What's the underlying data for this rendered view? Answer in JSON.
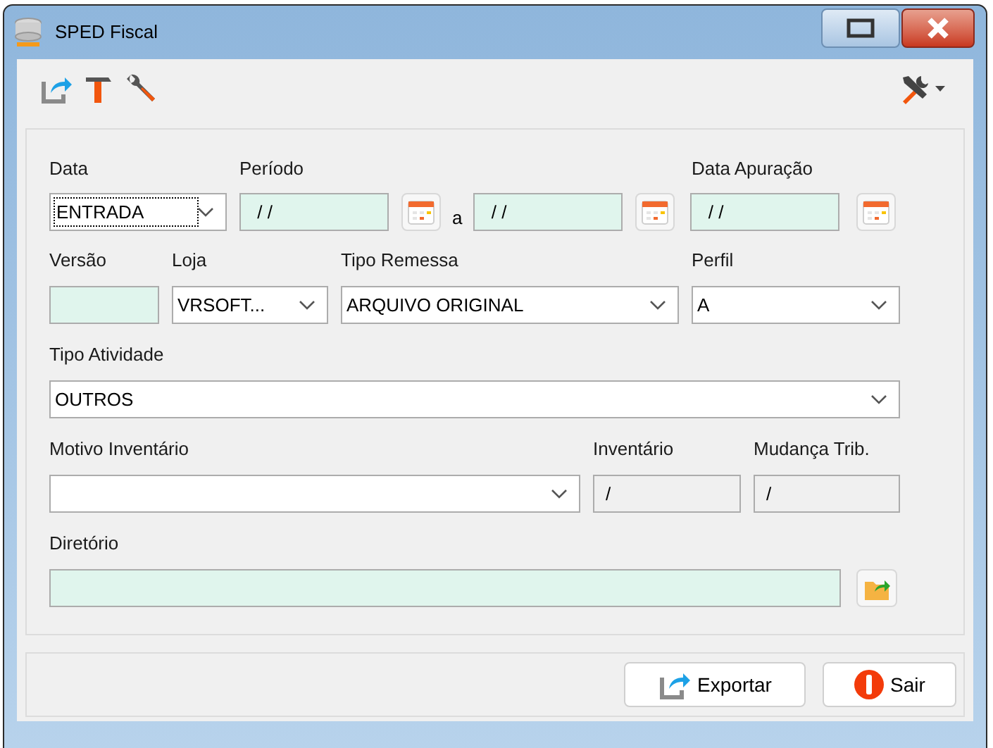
{
  "window": {
    "title": "SPED Fiscal"
  },
  "form": {
    "data": {
      "label": "Data",
      "value": "ENTRADA",
      "focused": true
    },
    "periodo": {
      "label": "Período",
      "start": " / /",
      "separator": "a",
      "end": " / /"
    },
    "data_apuracao": {
      "label": "Data Apuração",
      "value": " / /"
    },
    "versao": {
      "label": "Versão"
    },
    "loja": {
      "label": "Loja",
      "value": "VRSOFT..."
    },
    "tipo_remessa": {
      "label": "Tipo Remessa",
      "value": "ARQUIVO ORIGINAL"
    },
    "perfil": {
      "label": "Perfil",
      "value": "A"
    },
    "tipo_atividade": {
      "label": "Tipo Atividade",
      "value": "OUTROS"
    },
    "motivo_inventario": {
      "label": "Motivo Inventário"
    },
    "inventario": {
      "label": "Inventário",
      "value": "/",
      "disabled": true
    },
    "mudanca_trib": {
      "label": "Mudança Trib.",
      "value": "/",
      "disabled": true
    },
    "diretorio": {
      "label": "Diretório"
    }
  },
  "buttons": [
    {
      "label": "Exportar",
      "kind": "export"
    },
    {
      "label": "Sair",
      "kind": "exit"
    }
  ]
}
